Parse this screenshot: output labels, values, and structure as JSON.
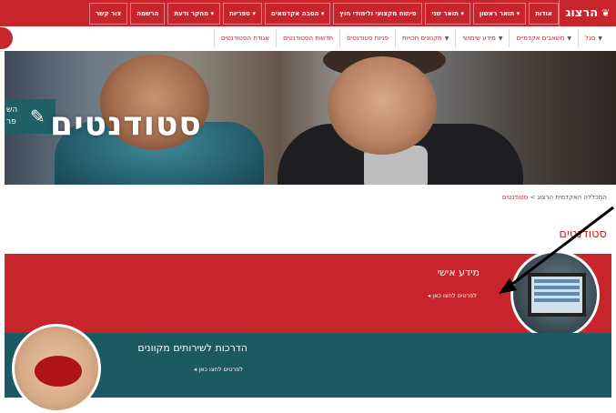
{
  "top_nav": {
    "logo": "הרצוג",
    "items": [
      "אודות",
      "תואר ראשון",
      "תואר שני",
      "פיתוח מקצועי ולימודי חוץ",
      "הסבה אקדמאים",
      "ספריות",
      "מחקר ודעת",
      "הרשמה",
      "צור קשר"
    ]
  },
  "sec_nav": {
    "items": [
      {
        "label": "סגל",
        "dropdown": true
      },
      {
        "label": "משאבים אקדמיים",
        "dropdown": true
      },
      {
        "label": "מידע שימושי",
        "dropdown": true
      },
      {
        "label": "תקנונים חכויות",
        "dropdown": true
      },
      {
        "label": "פניות סטודנטים",
        "dropdown": false
      },
      {
        "label": "חדשות הסטודנטים",
        "dropdown": false
      },
      {
        "label": "אגודת הסטודנטים",
        "dropdown": false
      }
    ]
  },
  "hero": {
    "title": "סטודנטים",
    "side_text_1": "הש",
    "side_text_2": "פר"
  },
  "breadcrumb": {
    "home": "המכללה האקדמית הרצוג",
    "separator": ">",
    "current": "סטודנטים"
  },
  "page_title": "סטודנטים",
  "cards": [
    {
      "title": "מידע אישי",
      "link": "לפרטים לחצו כאן"
    },
    {
      "title": "הדרכות לשירותים מקוונים",
      "link": "לפרטים לחצו כאן"
    }
  ],
  "colors": {
    "brand_red": "#c8242b",
    "teal": "#1c5a63"
  }
}
